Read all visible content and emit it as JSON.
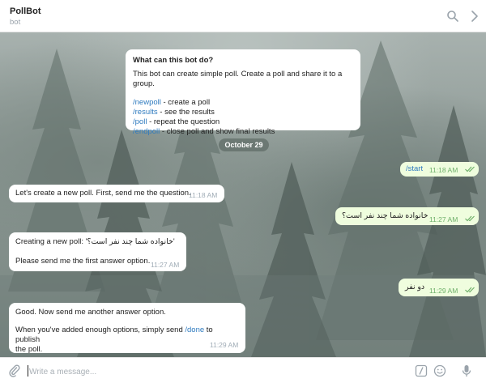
{
  "header": {
    "title": "PollBot",
    "subtitle": "bot",
    "search_icon": "search-icon",
    "more_icon": "chevron-right-icon"
  },
  "intro": {
    "heading": "What can this bot do?",
    "description": "This bot can create simple poll. Create a poll and share it to a group.",
    "commands": [
      {
        "cmd": "/newpoll",
        "desc": " - create a poll"
      },
      {
        "cmd": "/results",
        "desc": " - see the results"
      },
      {
        "cmd": "/poll",
        "desc": " - repeat the question"
      },
      {
        "cmd": "/endpoll",
        "desc": " - close poll and show final results"
      }
    ]
  },
  "date_separator": "October 29",
  "messages": [
    {
      "dir": "out",
      "text": "/start",
      "time": "11:18 AM"
    },
    {
      "dir": "in",
      "text": "Let's create a new poll. First, send me the question.",
      "time": "11:18 AM"
    },
    {
      "dir": "out",
      "text": "خانواده شما چند نفر است؟",
      "time": "11:27 AM"
    },
    {
      "dir": "in",
      "line1": "Creating a new poll: 'خانواده شما چند نفر است؟'",
      "line2": "Please send me the first answer option.",
      "time": "11:27 AM"
    },
    {
      "dir": "out",
      "text": "دو نفر",
      "time": "11:29 AM"
    },
    {
      "dir": "in",
      "line1": "Good. Now send me another answer option.",
      "line2_pre": "When you've added enough options, simply send ",
      "line2_link": "/done",
      "line2_post": " to publish",
      "line3": "the poll.",
      "time": "11:29 AM"
    }
  ],
  "composer": {
    "placeholder": "Write a message...",
    "attach_icon": "paperclip-icon",
    "commands_icon": "slash-command-icon",
    "emoji_icon": "emoji-icon",
    "mic_icon": "microphone-icon"
  },
  "colors": {
    "link": "#2f7bbf",
    "outgoing_bubble": "#effdde",
    "read_check": "#6fb06a"
  }
}
